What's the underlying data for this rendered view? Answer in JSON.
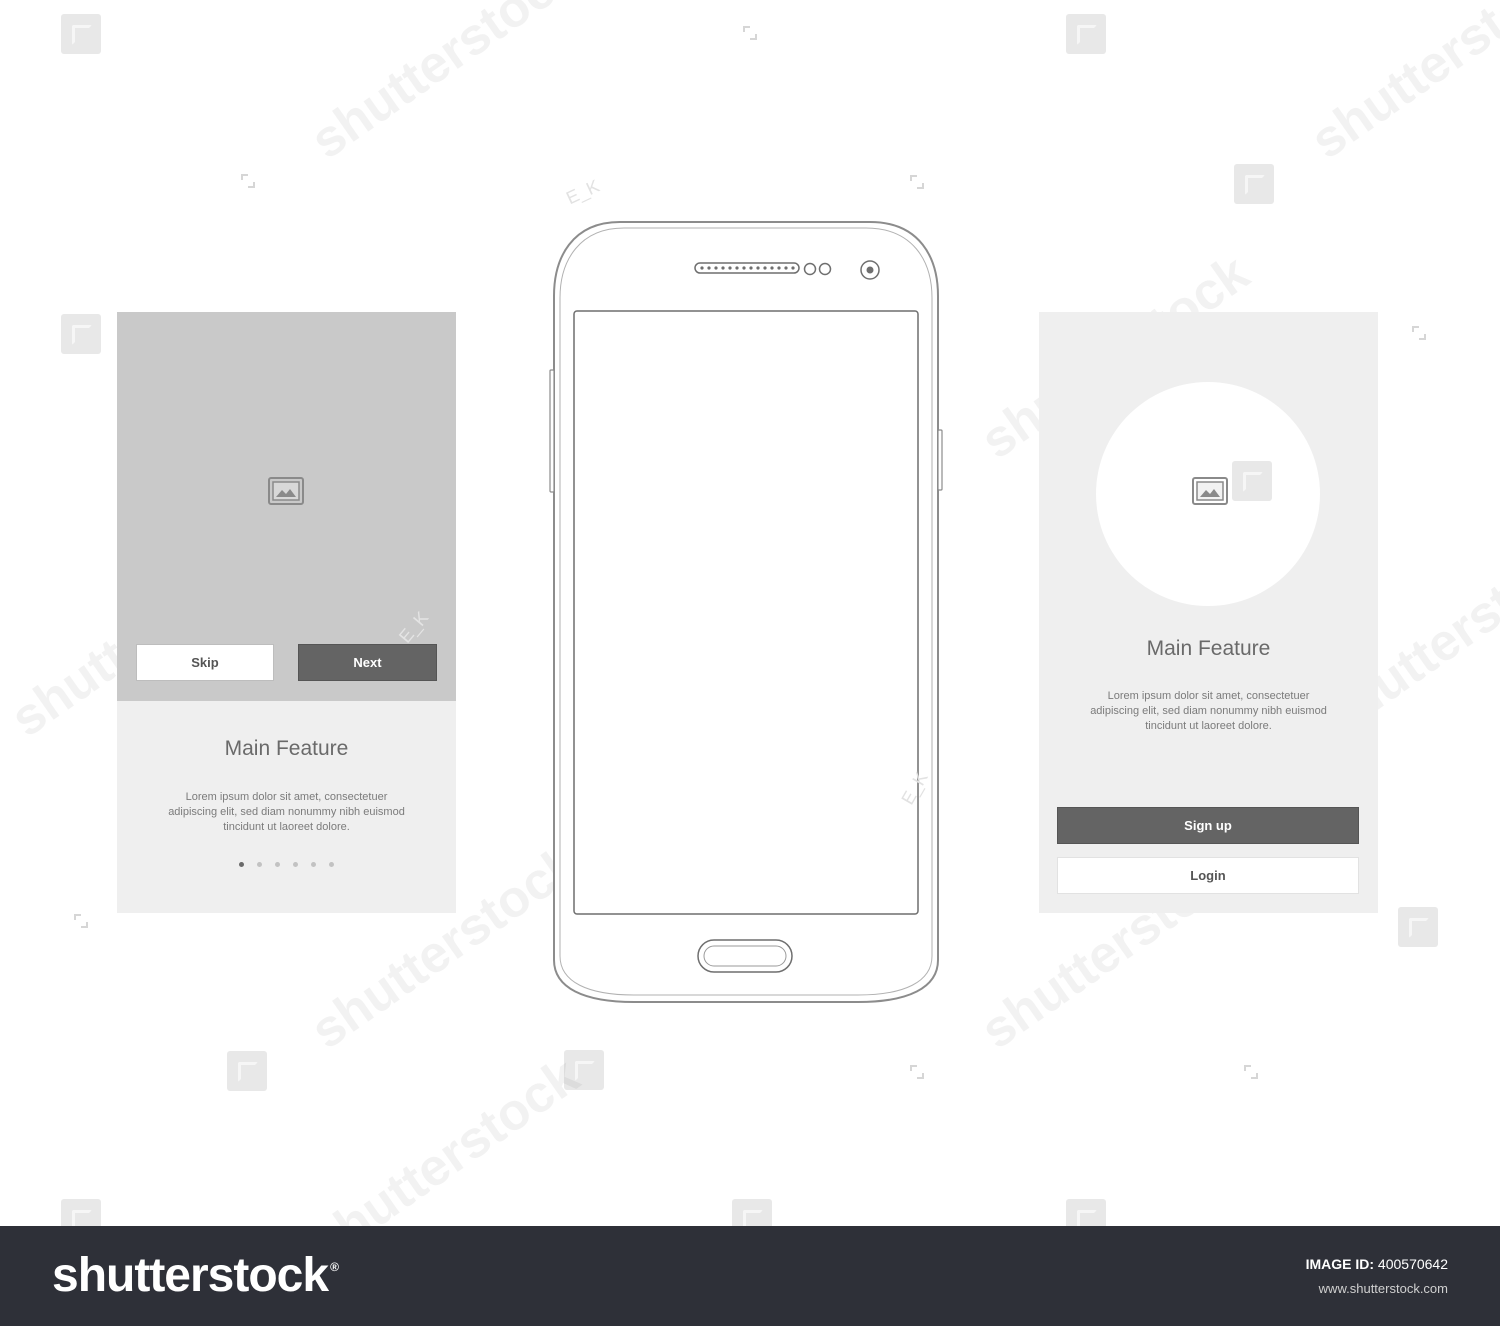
{
  "onboarding_screen": {
    "skip_label": "Skip",
    "next_label": "Next",
    "title": "Main Feature",
    "description_lines": [
      "Lorem ipsum dolor sit amet, consectetuer",
      "adipiscing elit, sed diam nonummy nibh euismod",
      "tincidunt ut laoreet dolore."
    ],
    "pager_pages": 6,
    "pager_active_index": 0
  },
  "login_screen": {
    "title": "Main Feature",
    "description_lines": [
      "Lorem ipsum dolor sit amet, consectetuer",
      "adipiscing elit, sed diam nonummy nibh euismod",
      "tincidunt ut laoreet dolore."
    ],
    "signup_label": "Sign up",
    "login_label": "Login"
  },
  "phone": {
    "device_icon": "smartphone-outline"
  },
  "watermark": {
    "text": "shutterstock",
    "initials": "E_K"
  },
  "footer": {
    "brand": "shutterstock",
    "brand_mark": "®",
    "image_id_label": "IMAGE ID:",
    "image_id": "400570642",
    "site": "www.shutterstock.com"
  },
  "colors": {
    "hero_gray": "#c9c9c9",
    "panel_gray": "#efefef",
    "button_dark": "#646464",
    "footer_bg": "#2e3038"
  }
}
